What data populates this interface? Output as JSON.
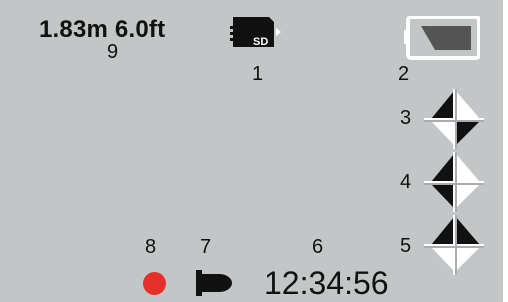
{
  "status": {
    "depth": "1.83m 6.0ft",
    "time": "12:34:56"
  },
  "legend": {
    "n1": "1",
    "n2": "2",
    "n3": "3",
    "n4": "4",
    "n5": "5",
    "n6": "6",
    "n7": "7",
    "n8": "8",
    "n9": "9"
  },
  "sd_card": {
    "label": "SD",
    "icon": "sd-card-icon"
  },
  "icons": {
    "battery": "battery-icon",
    "rotation_cross": "rotation-cross-icon",
    "record": "record-dot-icon",
    "light": "light-icon"
  },
  "colors": {
    "screen_background": "#c3c6c7",
    "record_red": "#e52f2a",
    "dark_gray": "#555555",
    "icon_black": "#111111",
    "icon_white": "#ffffff"
  }
}
